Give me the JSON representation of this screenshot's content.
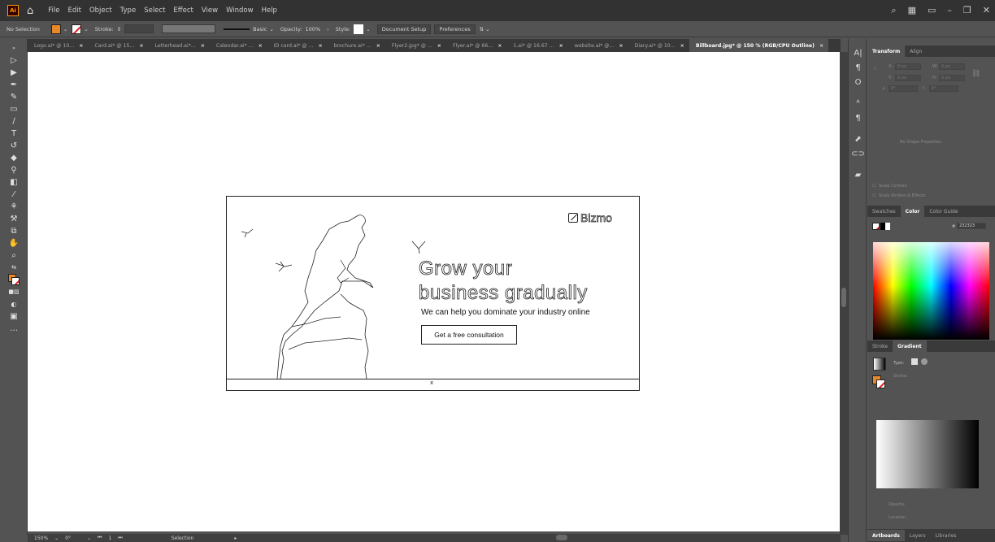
{
  "menubar": {
    "app_logo": "Ai",
    "menus": [
      "File",
      "Edit",
      "Object",
      "Type",
      "Select",
      "Effect",
      "View",
      "Window",
      "Help"
    ]
  },
  "controlbar": {
    "selection": "No Selection",
    "stroke_label": "Stroke:",
    "brush": "Basic",
    "opacity_label": "Opacity:",
    "opacity_value": "100%",
    "style_label": "Style:",
    "document_setup": "Document Setup",
    "preferences": "Preferences"
  },
  "tabs": [
    {
      "label": "Logo.ai* @ 10...",
      "active": false
    },
    {
      "label": "Card.ai* @ 15...",
      "active": false
    },
    {
      "label": "Letterhead.ai*...",
      "active": false
    },
    {
      "label": "Calendar.ai* ...",
      "active": false
    },
    {
      "label": "ID card.ai* @ ...",
      "active": false
    },
    {
      "label": "brochure.ai* ...",
      "active": false
    },
    {
      "label": "Flyer2.jpg* @ ...",
      "active": false
    },
    {
      "label": "Flyer.ai* @ 66...",
      "active": false
    },
    {
      "label": "1.ai* @ 16.67 ...",
      "active": false
    },
    {
      "label": "website.ai* @...",
      "active": false
    },
    {
      "label": "Diary.ai* @ 10...",
      "active": false
    },
    {
      "label": "Billboard.jpg* @ 150 % (RGB/CPU Outline)",
      "active": true
    }
  ],
  "artboard": {
    "logo": "Bizmo",
    "headline_line1": "Grow your",
    "headline_line2": "business gradually",
    "subline": "We can help you dominate your industry online",
    "cta": "Get a free consultation",
    "mark": "x"
  },
  "statusbar": {
    "zoom": "150%",
    "rotation": "0°",
    "artboard_num": "1",
    "tool": "Selection"
  },
  "panels": {
    "transform_tabs": [
      "Transform",
      "Align"
    ],
    "transform_fields": {
      "x": "X:",
      "y": "Y:",
      "w": "W:",
      "h": "H:",
      "x_unit": "0 px",
      "y_unit": "0 px",
      "w_unit": "0 px",
      "h_unit": "0 px",
      "angle": "0°",
      "shear": "0°"
    },
    "no_shape": "No Shape Properties",
    "scale_corners": "Scale Corners",
    "scale_strokes": "Scale Strokes & Effects",
    "color_tabs": [
      "Swatches",
      "Color",
      "Color Guide"
    ],
    "hex_label": "#",
    "hex_value": "232323",
    "gradient_tabs": [
      "Stroke",
      "Gradient"
    ],
    "gradient_type": "Type:",
    "gradient_stroke": "Stroke:",
    "opacity": "Opacity:",
    "location": "Location:",
    "bottom_tabs": [
      "Artboards",
      "Layers",
      "Libraries"
    ]
  },
  "colors": {
    "fill": "#e8882a",
    "accent": "#ff9a00"
  }
}
